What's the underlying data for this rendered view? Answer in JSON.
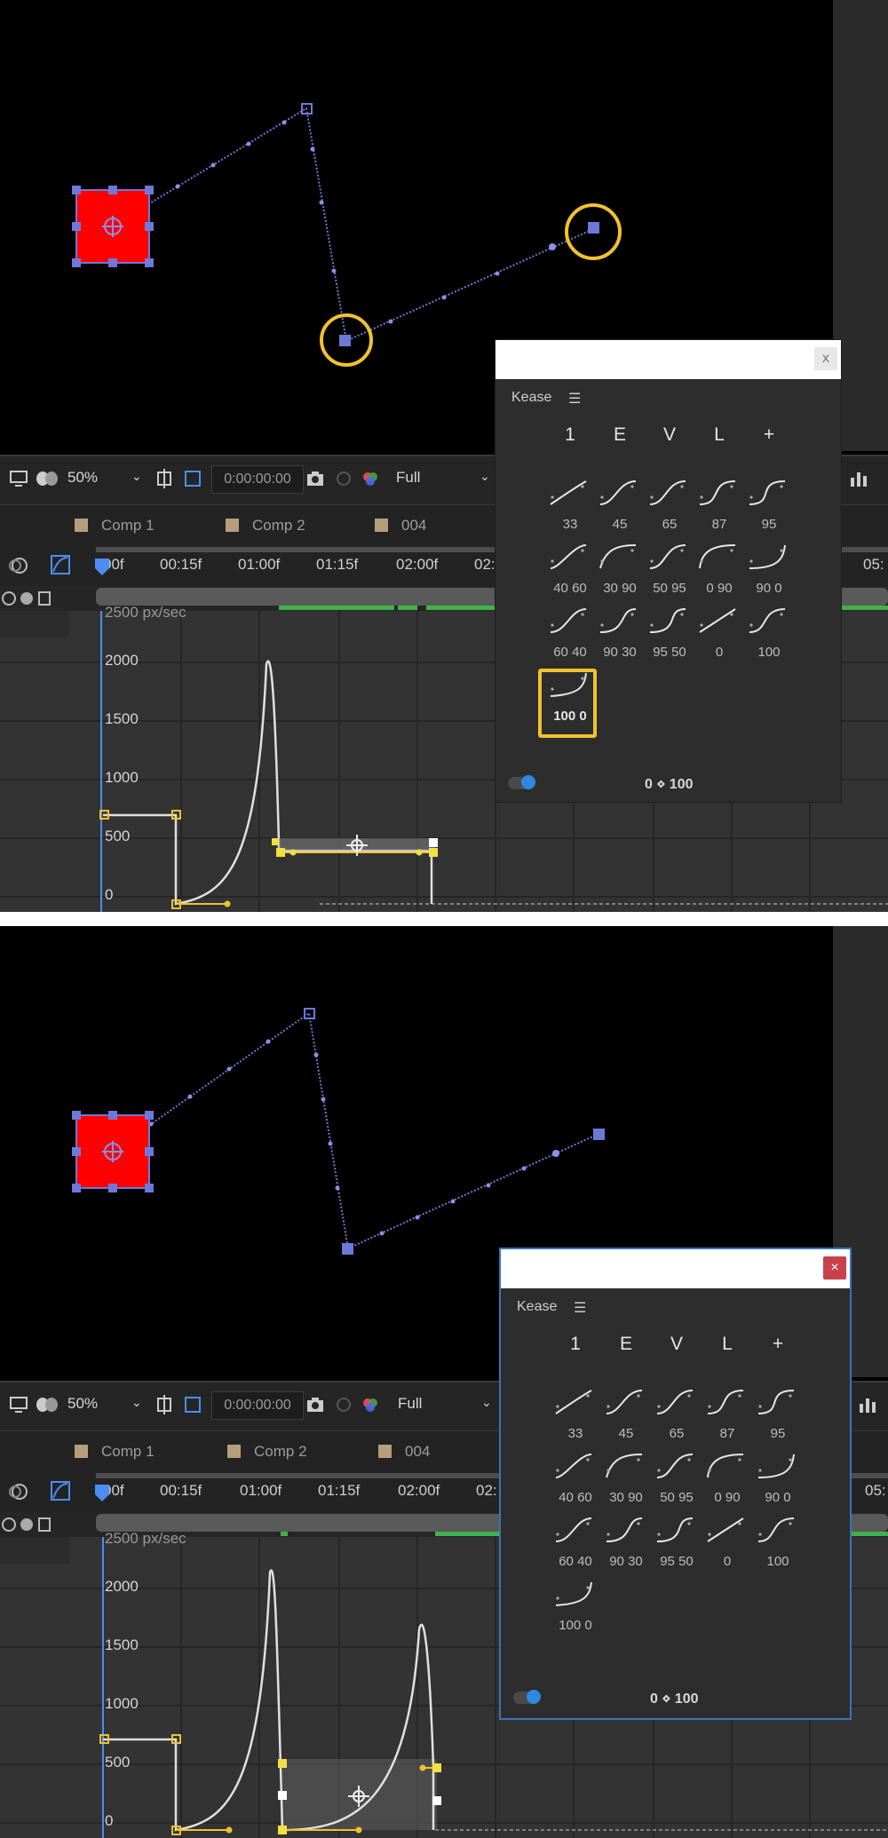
{
  "panels": [
    {
      "toolbar": {
        "zoom": "50%",
        "timecode": "0:00:00:00",
        "resolution": "Full"
      },
      "tabs": [
        "Comp 1",
        "Comp 2",
        "004"
      ],
      "ruler": [
        "00f",
        "00:15f",
        "01:00f",
        "01:15f",
        "02:00f",
        "02:",
        "05:"
      ],
      "graph": {
        "unit_label": "2500 px/sec",
        "y_ticks": [
          "2000",
          "1500",
          "1000",
          "500",
          "0"
        ]
      },
      "kease": {
        "title": "Kease",
        "close": "x",
        "top_buttons": [
          "1",
          "E",
          "V",
          "L",
          "+"
        ],
        "presets": [
          "33",
          "45",
          "65",
          "87",
          "95",
          "40 60",
          "30 90",
          "50 95",
          "0 90",
          "90 0",
          "60 40",
          "90 30",
          "95 50",
          "0",
          "100",
          "100 0"
        ],
        "selected_preset": "100 0",
        "footer": "0 ⋄ 100"
      }
    },
    {
      "toolbar": {
        "zoom": "50%",
        "timecode": "0:00:00:00",
        "resolution": "Full"
      },
      "tabs": [
        "Comp 1",
        "Comp 2",
        "004"
      ],
      "ruler": [
        "00f",
        "00:15f",
        "01:00f",
        "01:15f",
        "02:00f",
        "02:",
        "05:"
      ],
      "graph": {
        "unit_label": "2500 px/sec",
        "y_ticks": [
          "2000",
          "1500",
          "1000",
          "500",
          "0"
        ]
      },
      "kease": {
        "title": "Kease",
        "close": "×",
        "top_buttons": [
          "1",
          "E",
          "V",
          "L",
          "+"
        ],
        "presets": [
          "33",
          "45",
          "65",
          "87",
          "95",
          "40 60",
          "30 90",
          "50 95",
          "0 90",
          "90 0",
          "60 40",
          "90 30",
          "95 50",
          "0",
          "100",
          "100 0"
        ],
        "selected_preset": "",
        "footer": "0 ⋄ 100"
      }
    }
  ],
  "colors": {
    "accent_yellow": "#f0c22e",
    "path_blue": "#6e78d8",
    "layer_red": "#ff0000",
    "toggle_blue": "#2f88e0",
    "close_red": "#c8424b"
  }
}
